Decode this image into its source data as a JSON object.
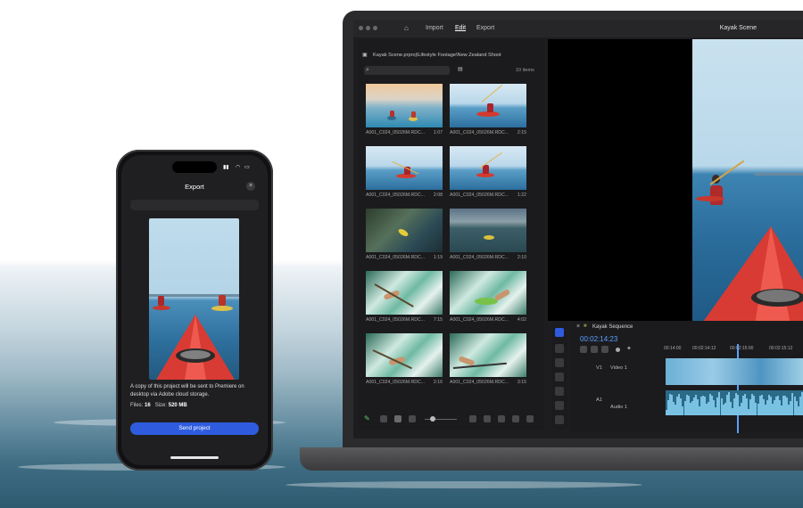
{
  "laptop": {
    "menu": {
      "import": "Import",
      "edit": "Edit",
      "export": "Export"
    },
    "window_title": "Kayak Scene",
    "media": {
      "path": "Kayak Scene.prproj\\Lifestyle Footage\\New Zealand Shoot",
      "item_count": "10 items",
      "clips": [
        {
          "name": "A001_C024_05026M.RDC...",
          "duration": "1:07"
        },
        {
          "name": "A001_C024_05026M.RDC...",
          "duration": "2:15"
        },
        {
          "name": "A001_C024_05026M.RDC...",
          "duration": "2:08"
        },
        {
          "name": "A001_C024_05026M.RDC...",
          "duration": "1:22"
        },
        {
          "name": "A001_C024_05026M.RDC...",
          "duration": "1:19"
        },
        {
          "name": "A001_C024_05026M.RDC...",
          "duration": "2:10"
        },
        {
          "name": "A001_C024_05026M.RDC...",
          "duration": "7:15"
        },
        {
          "name": "A001_C024_05026M.RDC...",
          "duration": "4:02"
        },
        {
          "name": "A001_C024_05026M.RDC...",
          "duration": "2:16"
        },
        {
          "name": "A001_C024_05026M.RDC...",
          "duration": "3:15"
        }
      ]
    },
    "timeline": {
      "sequence": "Kayak Sequence",
      "timecode": "00:02:14:23",
      "ticks": [
        "00:14:00",
        "00:02:14:12",
        "00:02:15:00",
        "00:02:15:12"
      ],
      "video_track": "V1",
      "video_label": "Video 1",
      "audio_track": "A1",
      "audio_label": "Audio 1"
    }
  },
  "phone": {
    "title": "Export",
    "copy_text": "A copy of this project will be sent to Premiere on desktop via Adobe cloud storage.",
    "files_label": "Files:",
    "files_value": "16",
    "size_label": "Size:",
    "size_value": "520 MB",
    "send_button": "Send project",
    "accent": "#2f5cdf"
  }
}
